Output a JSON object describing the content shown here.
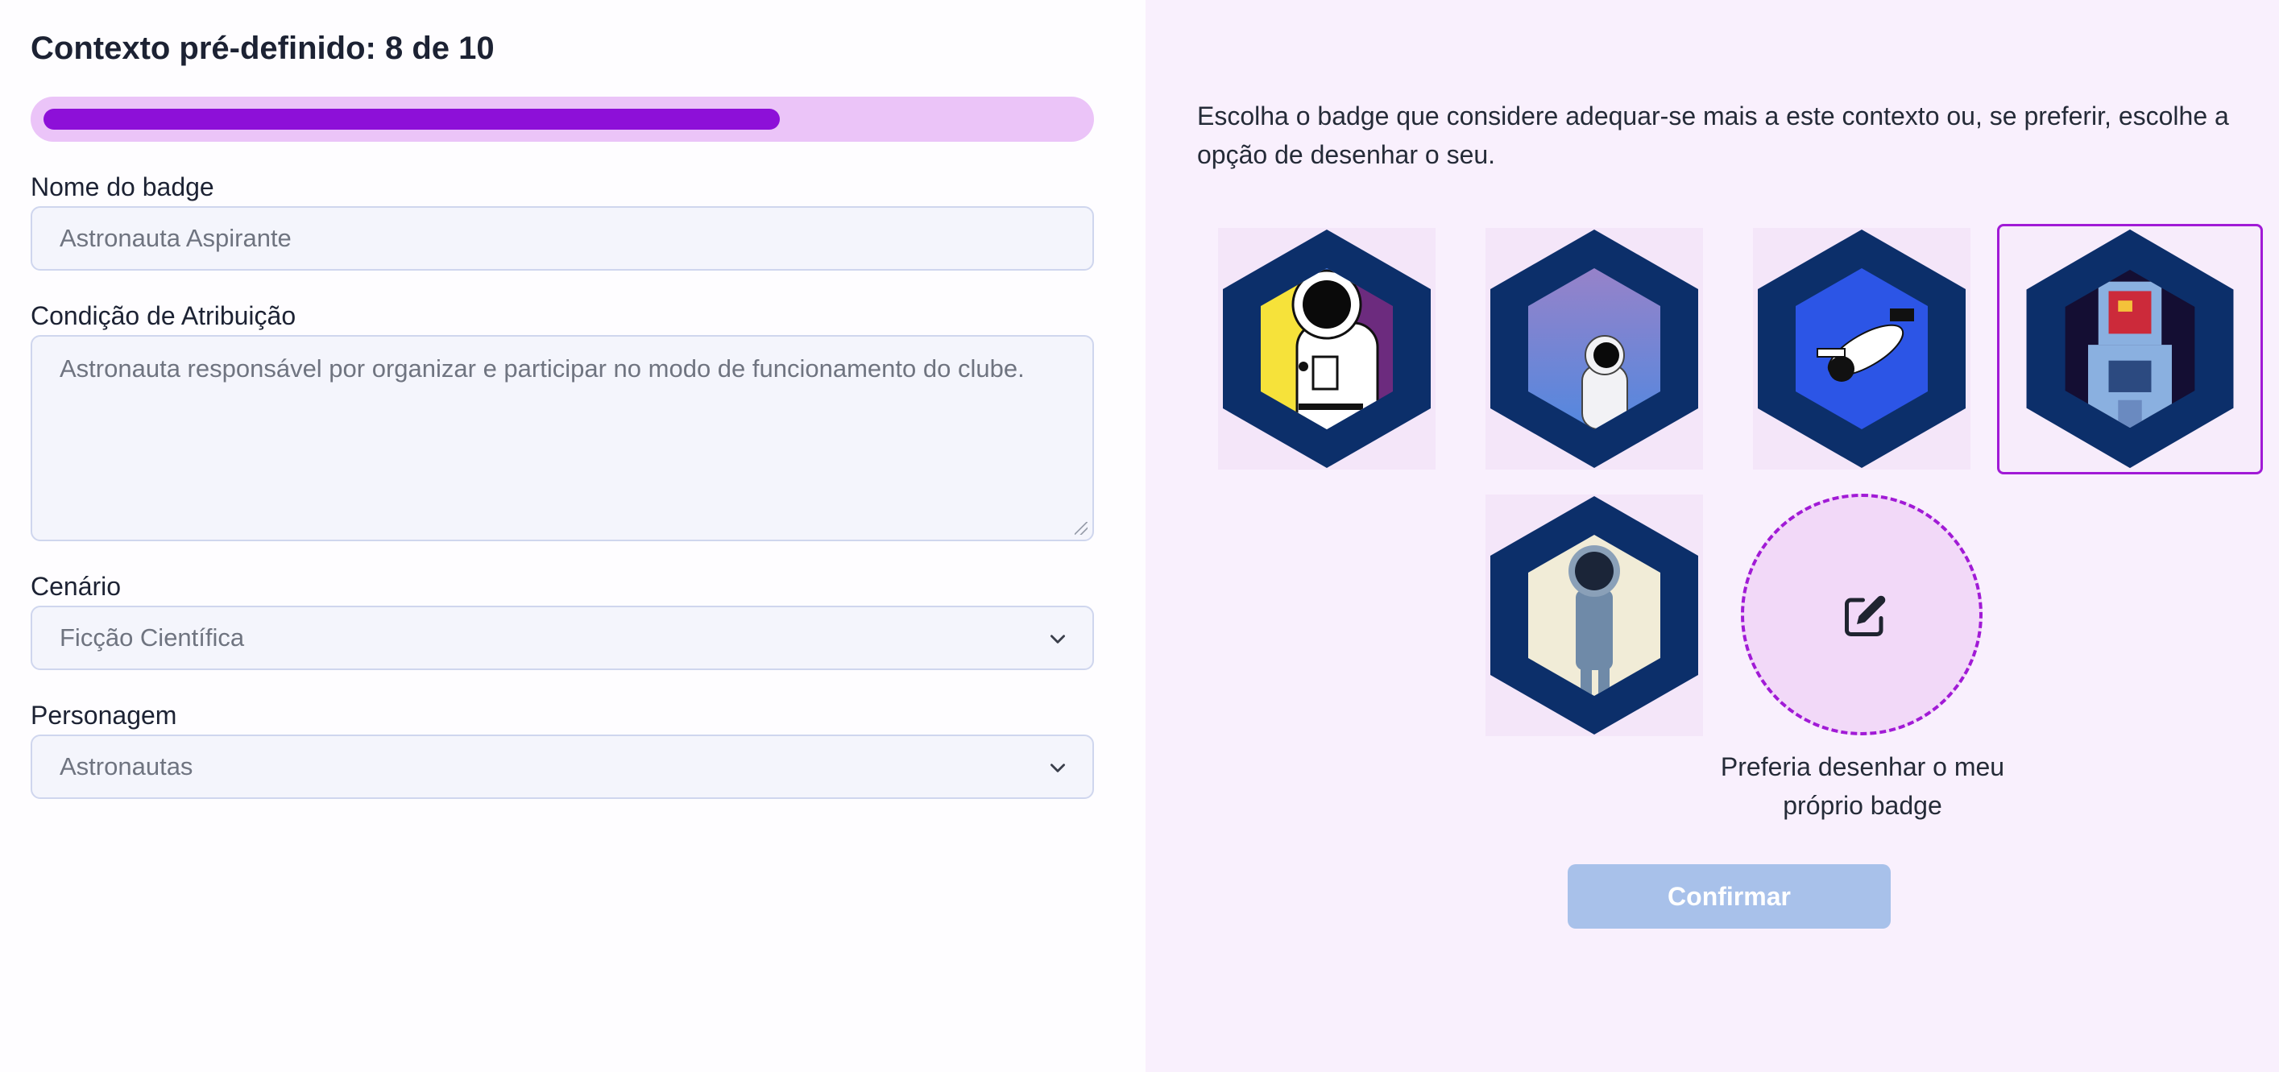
{
  "page": {
    "title": "Contexto pré-definido: 8 de 10",
    "progress": {
      "current": 8,
      "total": 10,
      "fraction": 0.71
    }
  },
  "form": {
    "badge_name": {
      "label": "Nome do badge",
      "value": "Astronauta Aspirante"
    },
    "condition": {
      "label": "Condição de Atribuição",
      "value": "Astronauta responsável por organizar e participar no modo de funcionamento do clube."
    },
    "scenario": {
      "label": "Cenário",
      "value": "Ficção Científica"
    },
    "character": {
      "label": "Personagem",
      "value": "Astronautas"
    }
  },
  "badges": {
    "instructions": "Escolha o badge que considere adequar-se mais a este contexto ou, se preferir, escolhe a opção de desenhar o seu.",
    "options": [
      {
        "icon": "astronaut-striped-badge-icon",
        "selected": false
      },
      {
        "icon": "astronaut-gradient-badge-icon",
        "selected": false
      },
      {
        "icon": "astronaut-floating-badge-icon",
        "selected": false
      },
      {
        "icon": "astronaut-pixel-badge-icon",
        "selected": true
      },
      {
        "icon": "astronaut-standing-badge-icon",
        "selected": false
      }
    ],
    "draw_own_label": "Preferia desenhar o meu próprio badge",
    "draw_icon": "edit-icon"
  },
  "actions": {
    "confirm_label": "Confirmar"
  },
  "colors": {
    "accent": "#8d10d8",
    "progress_track": "#ebc4f8",
    "right_panel_bg": "#f9f0fd",
    "badge_border": "#0c2f6a",
    "selected_border": "#a11ad6",
    "confirm_disabled": "#a8c1ea"
  }
}
